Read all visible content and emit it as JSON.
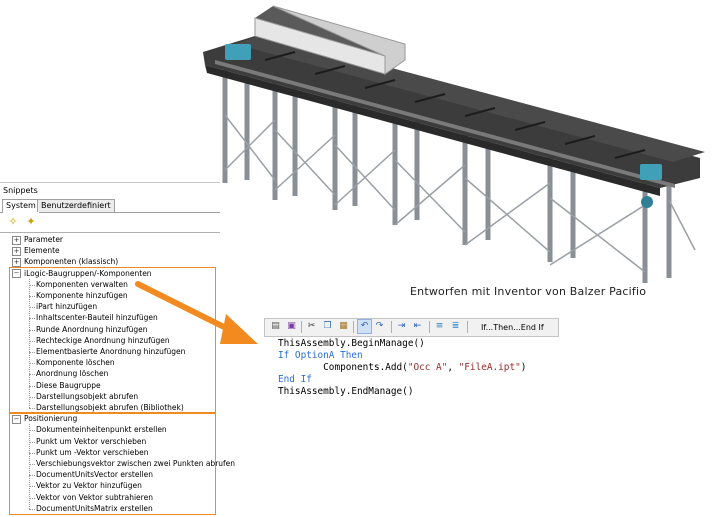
{
  "caption": "Entworfen mit Inventor von Balzer Pacifio",
  "snippets": {
    "title": "Snippets",
    "tabs": [
      "System",
      "Benutzerdefiniert"
    ],
    "toolbar_icons": [
      "add-snippet-icon",
      "edit-snippet-icon"
    ],
    "tree": [
      {
        "label": "Parameter",
        "type": "group",
        "expanded": false
      },
      {
        "label": "Elemente",
        "type": "group",
        "expanded": false
      },
      {
        "label": "Komponenten (klassisch)",
        "type": "group",
        "expanded": false
      },
      {
        "label": "iLogic-Baugruppen/-Komponenten",
        "type": "group",
        "expanded": true
      },
      {
        "label": "Komponenten verwalten",
        "type": "item"
      },
      {
        "label": "Komponente hinzufügen",
        "type": "item"
      },
      {
        "label": "iPart hinzufügen",
        "type": "item"
      },
      {
        "label": "Inhaltscenter-Bauteil hinzufügen",
        "type": "item"
      },
      {
        "label": "Runde Anordnung hinzufügen",
        "type": "item"
      },
      {
        "label": "Rechteckige Anordnung hinzufügen",
        "type": "item"
      },
      {
        "label": "Elementbasierte Anordnung hinzufügen",
        "type": "item"
      },
      {
        "label": "Komponente löschen",
        "type": "item"
      },
      {
        "label": "Anordnung löschen",
        "type": "item"
      },
      {
        "label": "Diese Baugruppe",
        "type": "item"
      },
      {
        "label": "Darstellungsobjekt abrufen",
        "type": "item"
      },
      {
        "label": "Darstellungsobjekt abrufen (Bibliothek)",
        "type": "item"
      },
      {
        "label": "Positionierung",
        "type": "group",
        "expanded": true
      },
      {
        "label": "Dokumenteinheitenpunkt erstellen",
        "type": "item"
      },
      {
        "label": "Punkt um Vektor verschieben",
        "type": "item"
      },
      {
        "label": "Punkt um -Vektor verschieben",
        "type": "item"
      },
      {
        "label": "Verschiebungsvektor zwischen zwei Punkten abrufen",
        "type": "item"
      },
      {
        "label": "DocumentUnitsVector erstellen",
        "type": "item"
      },
      {
        "label": "Vektor zu Vektor hinzufügen",
        "type": "item"
      },
      {
        "label": "Vektor von Vektor subtrahieren",
        "type": "item"
      },
      {
        "label": "DocumentUnitsMatrix erstellen",
        "type": "item"
      }
    ]
  },
  "editor": {
    "toolbar_icons": [
      "print-icon",
      "save-icon",
      "cut-icon",
      "copy-icon",
      "paste-icon",
      "undo-icon",
      "redo-icon",
      "indent-icon",
      "outdent-icon",
      "comment-icon",
      "uncomment-icon"
    ],
    "toolbar_label": "If...Then...End If",
    "code_lines": [
      [
        {
          "t": "ThisAssembly.BeginManage()",
          "c": "plain"
        }
      ],
      [
        {
          "t": "If OptionA Then",
          "c": "kw"
        }
      ],
      [
        {
          "t": "        Components.Add(",
          "c": "plain"
        },
        {
          "t": "\"Occ A\"",
          "c": "str"
        },
        {
          "t": ", ",
          "c": "plain"
        },
        {
          "t": "\"FileA.ipt\"",
          "c": "str"
        },
        {
          "t": ")",
          "c": "plain"
        }
      ],
      [
        {
          "t": "End If",
          "c": "kw"
        }
      ],
      [
        {
          "t": "ThisAssembly.EndManage()",
          "c": "plain"
        }
      ]
    ]
  },
  "colors": {
    "highlight": "#f28a20",
    "keyword": "#2a6fd6",
    "string": "#9a2a2a",
    "belt": "#3c3c3c",
    "frame": "#8a8f96",
    "motor": "#3fa0b8"
  }
}
